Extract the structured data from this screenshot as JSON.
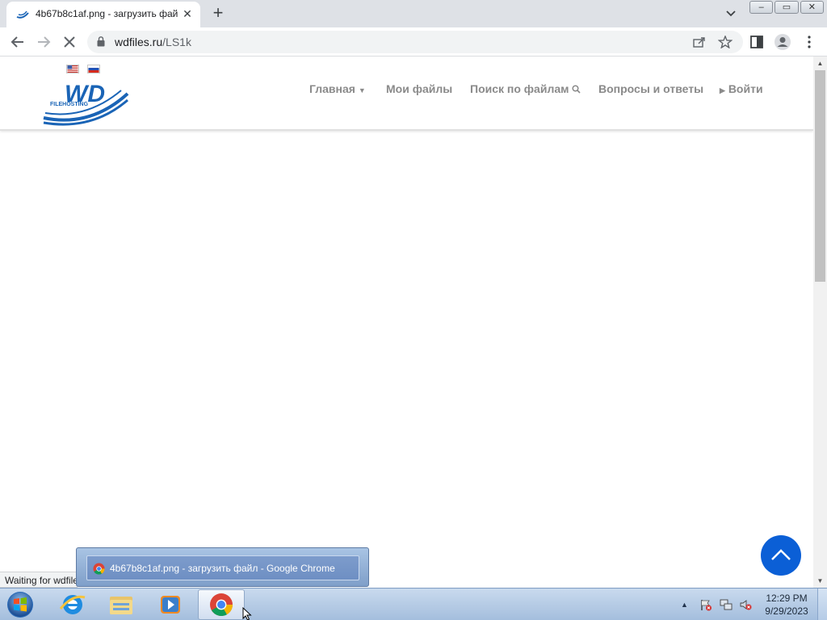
{
  "browser": {
    "tab": {
      "title": "4b67b8c1af.png - загрузить фай",
      "favicon": "wd-logo-icon"
    },
    "toolbar": {
      "back_icon": "back-arrow-icon",
      "forward_icon": "forward-arrow-icon",
      "stop_icon": "stop-icon",
      "url_host": "wdfiles.ru",
      "url_path": "/LS1k"
    },
    "window_buttons": {
      "minimize": "‒",
      "maximize": "▭",
      "close": "✕"
    }
  },
  "site": {
    "logo_text": "WD",
    "logo_subtext": "FILEHOSTING",
    "nav": [
      {
        "label": "Главная",
        "icon": "caret-down-icon"
      },
      {
        "label": "Мои файлы"
      },
      {
        "label": "Поиск по файлам",
        "icon": "search-icon"
      },
      {
        "label": "Вопросы и ответы"
      },
      {
        "label": "Войти",
        "icon": "caret-right-icon"
      }
    ],
    "colors": {
      "logo_blue": "#1a64b6",
      "scroll_top_button": "#0b5fd6",
      "nav_text": "#8a8a8a"
    }
  },
  "status_text": "Waiting for wdfiles.ru...",
  "thumbnail_popup": {
    "title": "4b67b8c1af.png - загрузить файл - Google Chrome"
  },
  "taskbar": {
    "apps": [
      "internet-explorer-icon",
      "file-explorer-icon",
      "media-player-icon",
      "chrome-icon"
    ],
    "clock_time": "12:29 PM",
    "clock_date": "9/29/2023"
  }
}
